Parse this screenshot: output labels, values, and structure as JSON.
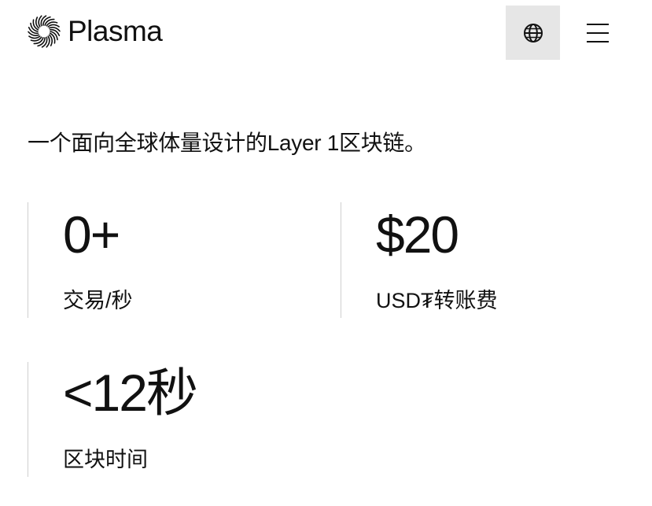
{
  "header": {
    "logo_text": "Plasma",
    "logo_icon": "plasma-burst-icon",
    "language_icon": "globe-icon",
    "menu_icon": "hamburger-menu-icon"
  },
  "hero": {
    "tagline": "一个面向全球体量设计的Layer 1区块链。"
  },
  "stats": [
    {
      "value": "0+",
      "label": "交易/秒"
    },
    {
      "value": "$20",
      "label": "USD₮转账费"
    },
    {
      "value": "<12秒",
      "label": "区块时间"
    }
  ],
  "colors": {
    "background": "#ffffff",
    "text": "#111111",
    "button_bg": "#e6e6e6",
    "divider": "#cfcfcf"
  }
}
